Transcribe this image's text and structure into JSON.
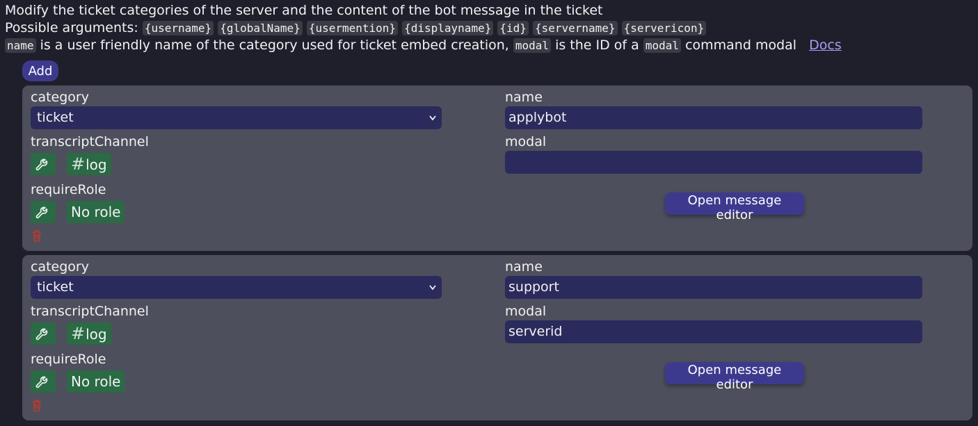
{
  "intro": {
    "line1": "Modify the ticket categories of the server and the content of the bot message in the ticket",
    "line2_prefix": "Possible arguments:",
    "arguments": [
      "{username}",
      "{globalName}",
      "{usermention}",
      "{displayname}",
      "{id}",
      "{servername}",
      "{servericon}"
    ],
    "line3": {
      "code_name": "name",
      "text1": "is a user friendly name of the category used for ticket embed creation,",
      "code_modal": "modal",
      "text2": "is the ID of a",
      "code_modal2": "modal",
      "text3": "command modal",
      "docs_link": "Docs"
    }
  },
  "add_button": "Add",
  "labels": {
    "category": "category",
    "name": "name",
    "transcript": "transcriptChannel",
    "modal": "modal",
    "require_role": "requireRole",
    "message_editor": "Open message editor"
  },
  "categories": [
    {
      "category": "ticket",
      "name": "applybot",
      "transcript_channel": "log",
      "modal": "",
      "require_role": "No role"
    },
    {
      "category": "ticket",
      "name": "support",
      "transcript_channel": "log",
      "modal": "serverid",
      "require_role": "No role"
    }
  ],
  "colors": {
    "background": "#1e1f2b",
    "card": "#4e4f5c",
    "input": "#2b2a5c",
    "button": "#3d3a8e",
    "chip": "#2a6a45",
    "link": "#a99cf7",
    "delete": "#c0392b"
  },
  "icons": {
    "picker": "wrench-icon",
    "channel": "hash-icon",
    "delete": "trash-icon",
    "dropdown": "chevron-down-icon"
  }
}
